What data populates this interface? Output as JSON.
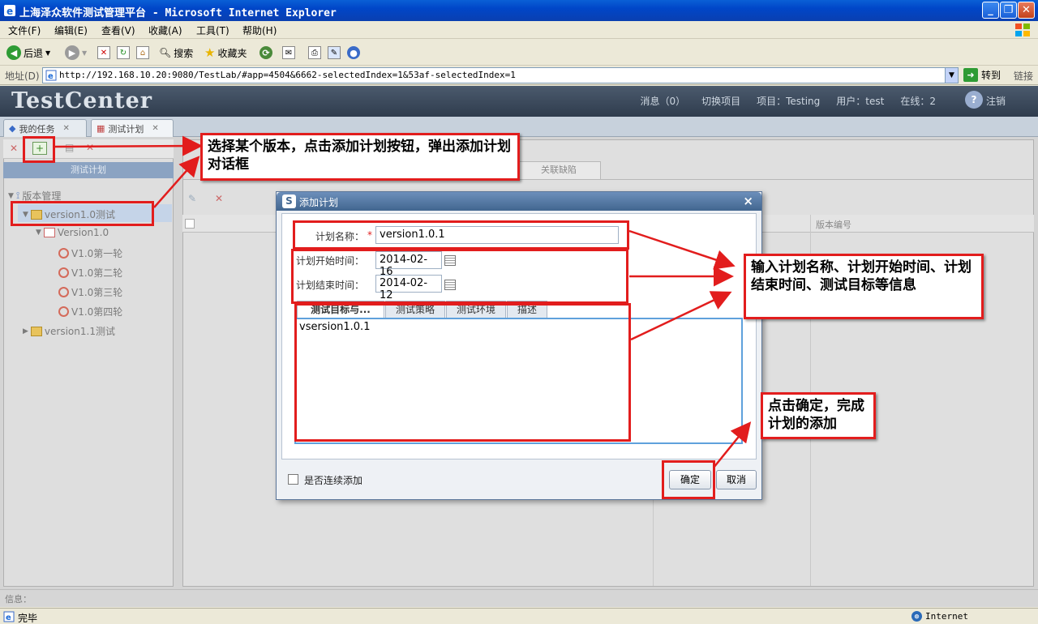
{
  "window": {
    "title": "上海泽众软件测试管理平台 - Microsoft Internet Explorer"
  },
  "menu": [
    "文件(F)",
    "编辑(E)",
    "查看(V)",
    "收藏(A)",
    "工具(T)",
    "帮助(H)"
  ],
  "toolbar": {
    "back": "后退",
    "search": "搜索",
    "favorites": "收藏夹"
  },
  "address": {
    "label": "地址(D)",
    "url": "http://192.168.10.20:9080/TestLab/#app=4504&6662-selectedIndex=1&53af-selectedIndex=1",
    "go": "转到",
    "links": "链接"
  },
  "app": {
    "logo": "TestCenter",
    "header": {
      "messages": "消息（0）",
      "switch_project": "切换项目",
      "project": "项目：Testing",
      "user": "用户：test",
      "online": "在线：2",
      "logout": "注销"
    },
    "tabs": [
      "我的任务",
      "测试计划"
    ],
    "left_panel_title": "测试计划",
    "tree": {
      "root": "版本管理",
      "selected": "version1.0测试",
      "child": "Version1.0",
      "rounds": [
        "V1.0第一轮",
        "V1.0第二轮",
        "V1.0第三轮",
        "V1.0第四轮"
      ],
      "other": "version1.1测试"
    },
    "right_tab": "关联缺陷",
    "grid_columns": [
      "版本编号"
    ],
    "info_label": "信息："
  },
  "dialog": {
    "title": "添加计划",
    "name_label": "计划名称：",
    "required_mark": "*",
    "name_value": "version1.0.1",
    "start_label": "计划开始时间：",
    "start_value": "2014-02-16",
    "end_label": "计划结束时间：",
    "end_value": "2014-02-12",
    "subtabs": [
      "测试目标与...",
      "测试策略",
      "测试环境",
      "描述"
    ],
    "target_text": "vsersion1.0.1",
    "continuous_label": "是否连续添加",
    "ok": "确定",
    "cancel": "取消"
  },
  "annotations": {
    "step1": "选择某个版本，点击添加计划按钮，弹出添加计划对话框",
    "step2": "输入计划名称、计划开始时间、计划结束时间、测试目标等信息",
    "step3": "点击确定，完成计划的添加"
  },
  "status": {
    "done": "完毕",
    "zone": "Internet"
  },
  "colors": {
    "annotation_red": "#e21d1d",
    "title_blue": "#0a5fd6"
  }
}
